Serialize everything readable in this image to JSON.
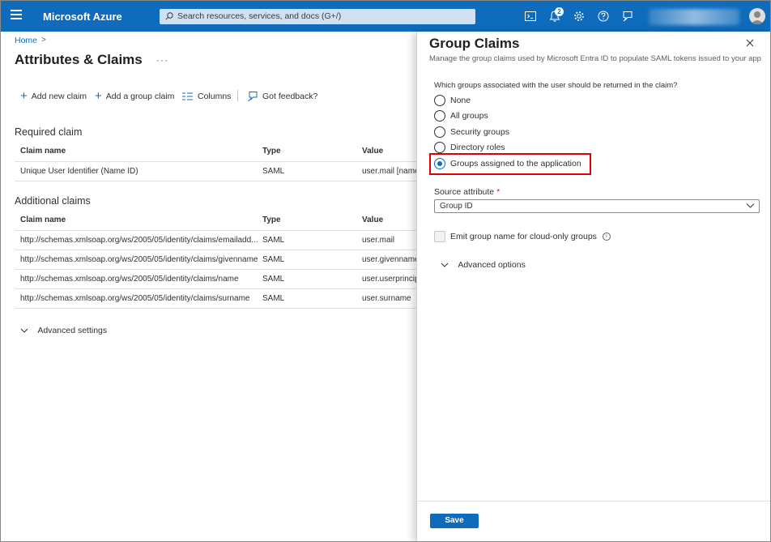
{
  "topbar": {
    "brand": "Microsoft Azure",
    "search_placeholder": "Search resources, services, and docs (G+/)",
    "notification_count": "2",
    "accent": "#0f6cbd"
  },
  "page": {
    "breadcrumb": "Home",
    "breadcrumb_sep": ">",
    "title": "Attributes & Claims",
    "more": "···"
  },
  "commands": {
    "add_new_claim": "Add new claim",
    "add_group_claim": "Add a group claim",
    "columns": "Columns",
    "feedback": "Got feedback?"
  },
  "required": {
    "title": "Required claim",
    "headers": [
      "Claim name",
      "Type",
      "Value"
    ],
    "rows": [
      {
        "name": "Unique User Identifier (Name ID)",
        "type": "SAML",
        "value": "user.mail [name"
      }
    ]
  },
  "additional": {
    "title": "Additional claims",
    "headers": [
      "Claim name",
      "Type",
      "Value"
    ],
    "rows": [
      {
        "name": "http://schemas.xmlsoap.org/ws/2005/05/identity/claims/emailadd...",
        "type": "SAML",
        "value": "user.mail"
      },
      {
        "name": "http://schemas.xmlsoap.org/ws/2005/05/identity/claims/givenname",
        "type": "SAML",
        "value": "user.givenname"
      },
      {
        "name": "http://schemas.xmlsoap.org/ws/2005/05/identity/claims/name",
        "type": "SAML",
        "value": "user.userprincip"
      },
      {
        "name": "http://schemas.xmlsoap.org/ws/2005/05/identity/claims/surname",
        "type": "SAML",
        "value": "user.surname"
      }
    ]
  },
  "advanced_settings": "Advanced settings",
  "panel": {
    "title": "Group Claims",
    "subtitle": "Manage the group claims used by Microsoft Entra ID to populate SAML tokens issued to your app",
    "question": "Which groups associated with the user should be returned in the claim?",
    "options": [
      {
        "label": "None",
        "checked": false
      },
      {
        "label": "All groups",
        "checked": false
      },
      {
        "label": "Security groups",
        "checked": false
      },
      {
        "label": "Directory roles",
        "checked": false
      },
      {
        "label": "Groups assigned to the application",
        "checked": true
      }
    ],
    "source_label": "Source attribute",
    "required_mark": "*",
    "source_value": "Group ID",
    "emit_label": "Emit group name for cloud-only groups",
    "info": "i",
    "advanced_options": "Advanced options",
    "save": "Save",
    "highlight_color": "#e00000"
  }
}
